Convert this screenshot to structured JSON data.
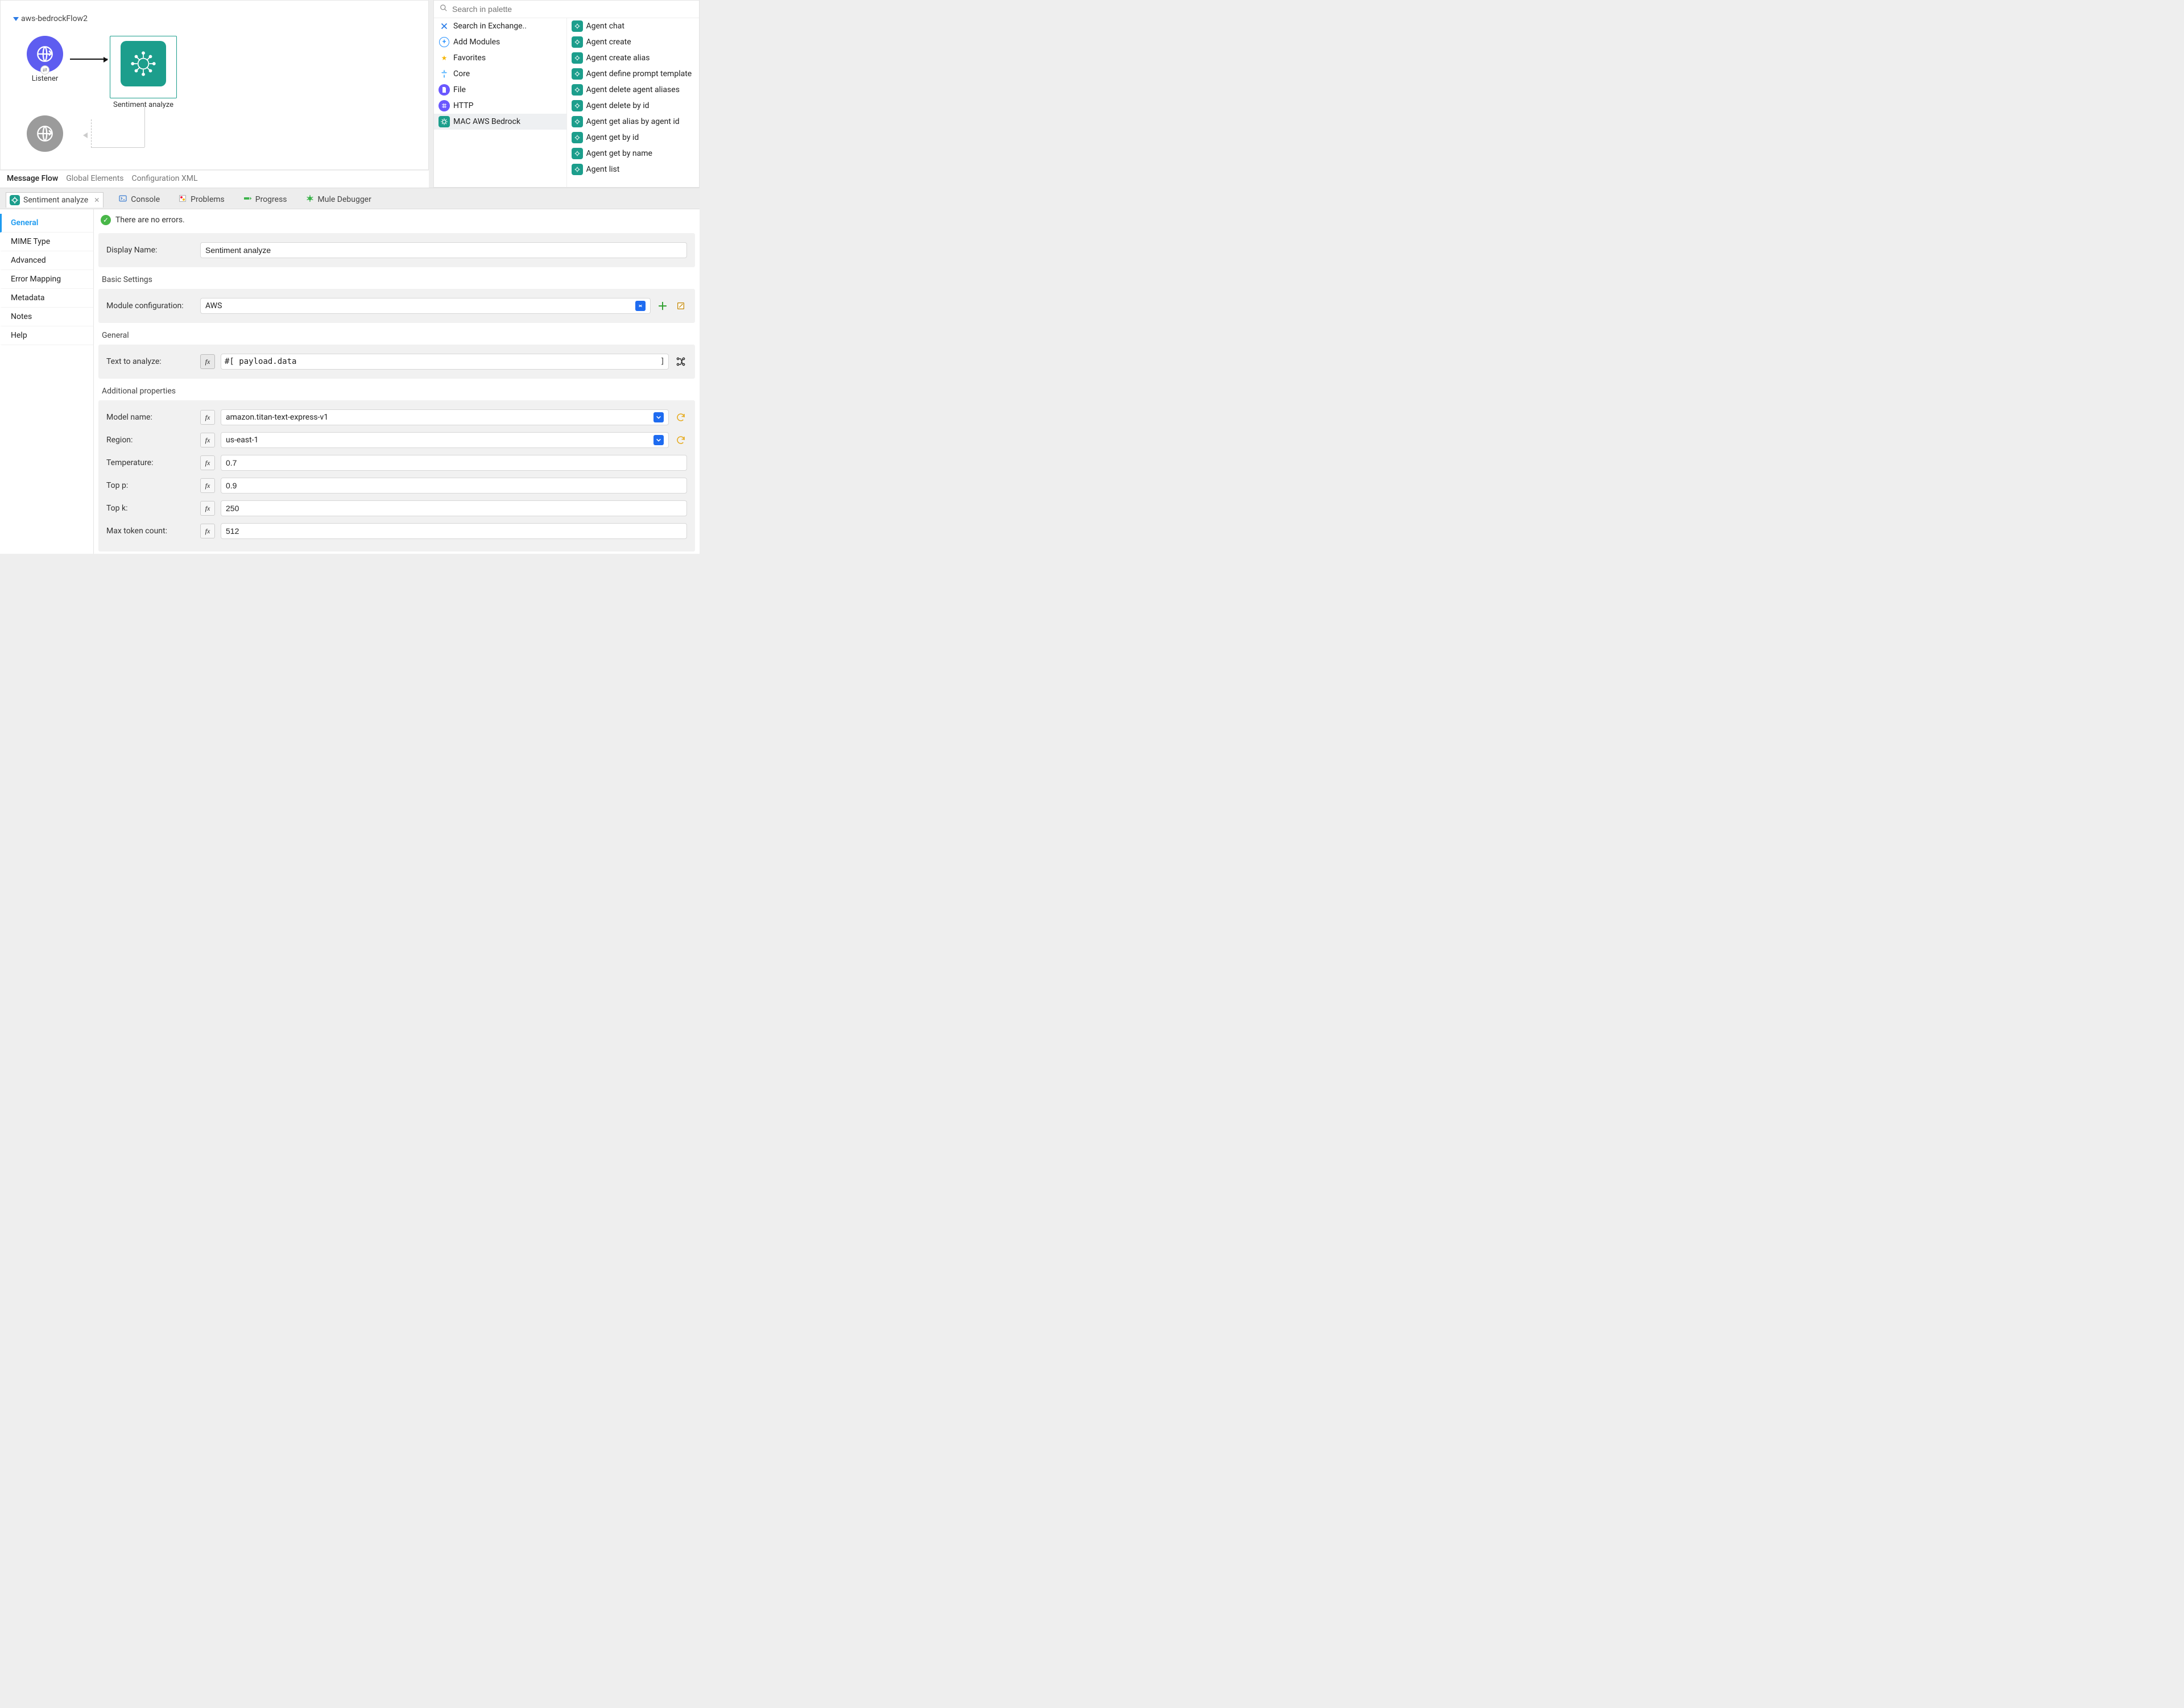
{
  "flow": {
    "title": "aws-bedrockFlow2",
    "nodes": {
      "listener": "Listener",
      "sentiment": "Sentiment analyze"
    }
  },
  "canvas_tabs": {
    "msg_flow": "Message Flow",
    "global_elem": "Global Elements",
    "config_xml": "Configuration XML"
  },
  "palette": {
    "search_placeholder": "Search in palette",
    "left": {
      "exchange": "Search in Exchange..",
      "add_modules": "Add Modules",
      "favorites": "Favorites",
      "core": "Core",
      "file": "File",
      "http": "HTTP",
      "bedrock": "MAC AWS Bedrock"
    },
    "right": [
      "Agent chat",
      "Agent create",
      "Agent create alias",
      "Agent define prompt template",
      "Agent delete agent aliases",
      "Agent delete by id",
      "Agent get alias by agent id",
      "Agent get by id",
      "Agent get by name",
      "Agent list"
    ]
  },
  "mid_tabs": {
    "prop": "Sentiment analyze",
    "console": "Console",
    "problems": "Problems",
    "progress": "Progress",
    "debugger": "Mule Debugger"
  },
  "side_tabs": {
    "general": "General",
    "mime": "MIME Type",
    "advanced": "Advanced",
    "errmap": "Error Mapping",
    "metadata": "Metadata",
    "notes": "Notes",
    "help": "Help"
  },
  "status": {
    "no_errors": "There are no errors."
  },
  "form": {
    "display_name_label": "Display Name:",
    "display_name": "Sentiment analyze",
    "basic_settings": "Basic Settings",
    "module_config_label": "Module configuration:",
    "module_config": "AWS",
    "general": "General",
    "text_to_analyze_label": "Text to analyze:",
    "text_to_analyze_prefix": "#[",
    "text_to_analyze": "payload.data",
    "text_to_analyze_suffix": "]",
    "additional_props": "Additional properties",
    "model_name_label": "Model name:",
    "model_name": "amazon.titan-text-express-v1",
    "region_label": "Region:",
    "region": "us-east-1",
    "temperature_label": "Temperature:",
    "temperature": "0.7",
    "top_p_label": "Top p:",
    "top_p": "0.9",
    "top_k_label": "Top k:",
    "top_k": "250",
    "max_token_label": "Max token count:",
    "max_token": "512"
  }
}
